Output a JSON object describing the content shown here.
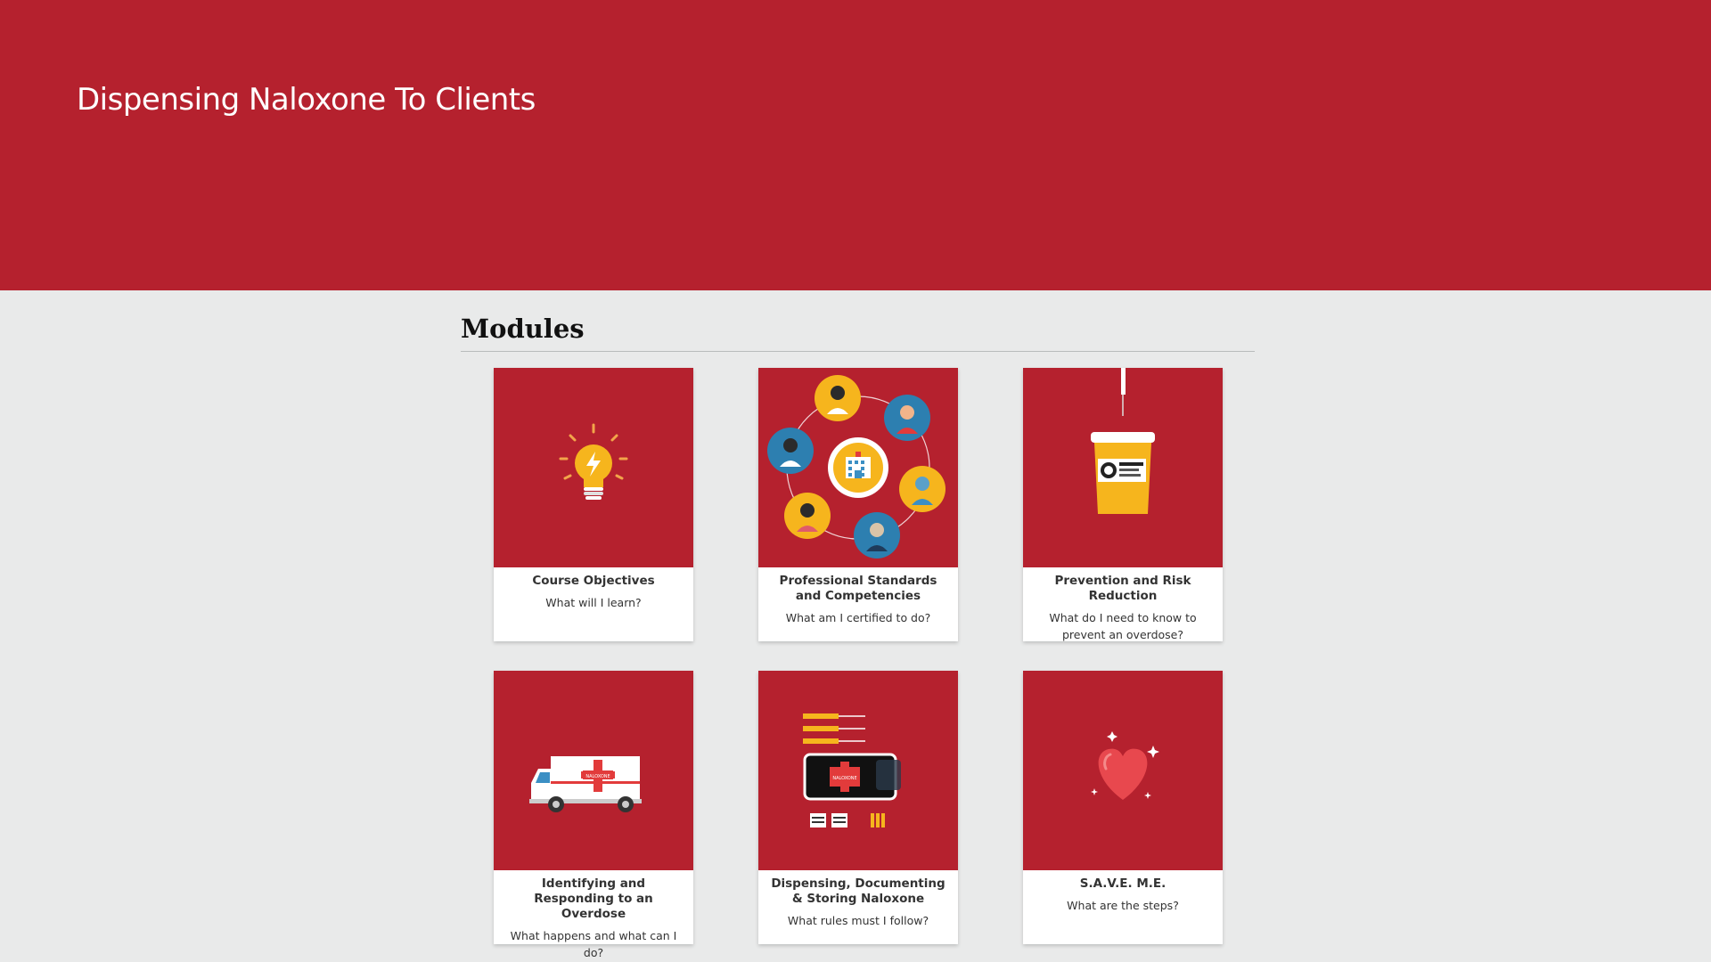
{
  "header": {
    "title": "Dispensing Naloxone To Clients",
    "background_color": "#b5212e"
  },
  "modules": {
    "heading": "Modules",
    "cards": [
      {
        "title": "Course Objectives",
        "subtitle": "What will I learn?",
        "icon": "lightbulb-icon"
      },
      {
        "title": "Professional Standards and Competencies",
        "subtitle": "What am I certified to do?",
        "icon": "healthcare-team-icon"
      },
      {
        "title": "Prevention and Risk Reduction",
        "subtitle": "What do I need to know to prevent an overdose?",
        "icon": "sharps-container-icon"
      },
      {
        "title": "Identifying and Responding to an Overdose",
        "subtitle": "What happens and what can I do?",
        "icon": "ambulance-icon"
      },
      {
        "title": "Dispensing, Documenting & Storing Naloxone",
        "subtitle": "What rules must I follow?",
        "icon": "naloxone-kit-icon"
      },
      {
        "title": "S.A.V.E. M.E.",
        "subtitle": "What are the steps?",
        "icon": "heart-icon"
      }
    ],
    "card_image_color": "#b5212e",
    "ambulance_label": "NALOXONE",
    "kit_label": "NALOXONE"
  }
}
